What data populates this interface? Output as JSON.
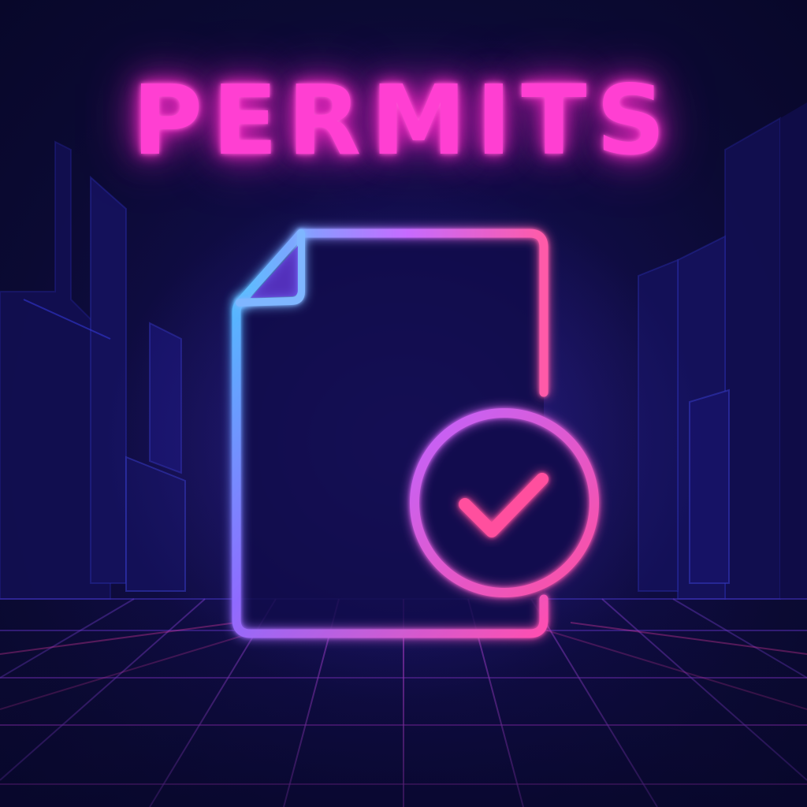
{
  "header": {
    "title": "PERMITS"
  },
  "icons": {
    "document": "document-icon",
    "check": "check-circle-icon"
  },
  "colors": {
    "background": "#0b0a33",
    "title": "#ff3fd2",
    "neon_blue": "#4fa8ff",
    "neon_purple": "#8a5cff",
    "neon_pink": "#ff4fb8"
  }
}
